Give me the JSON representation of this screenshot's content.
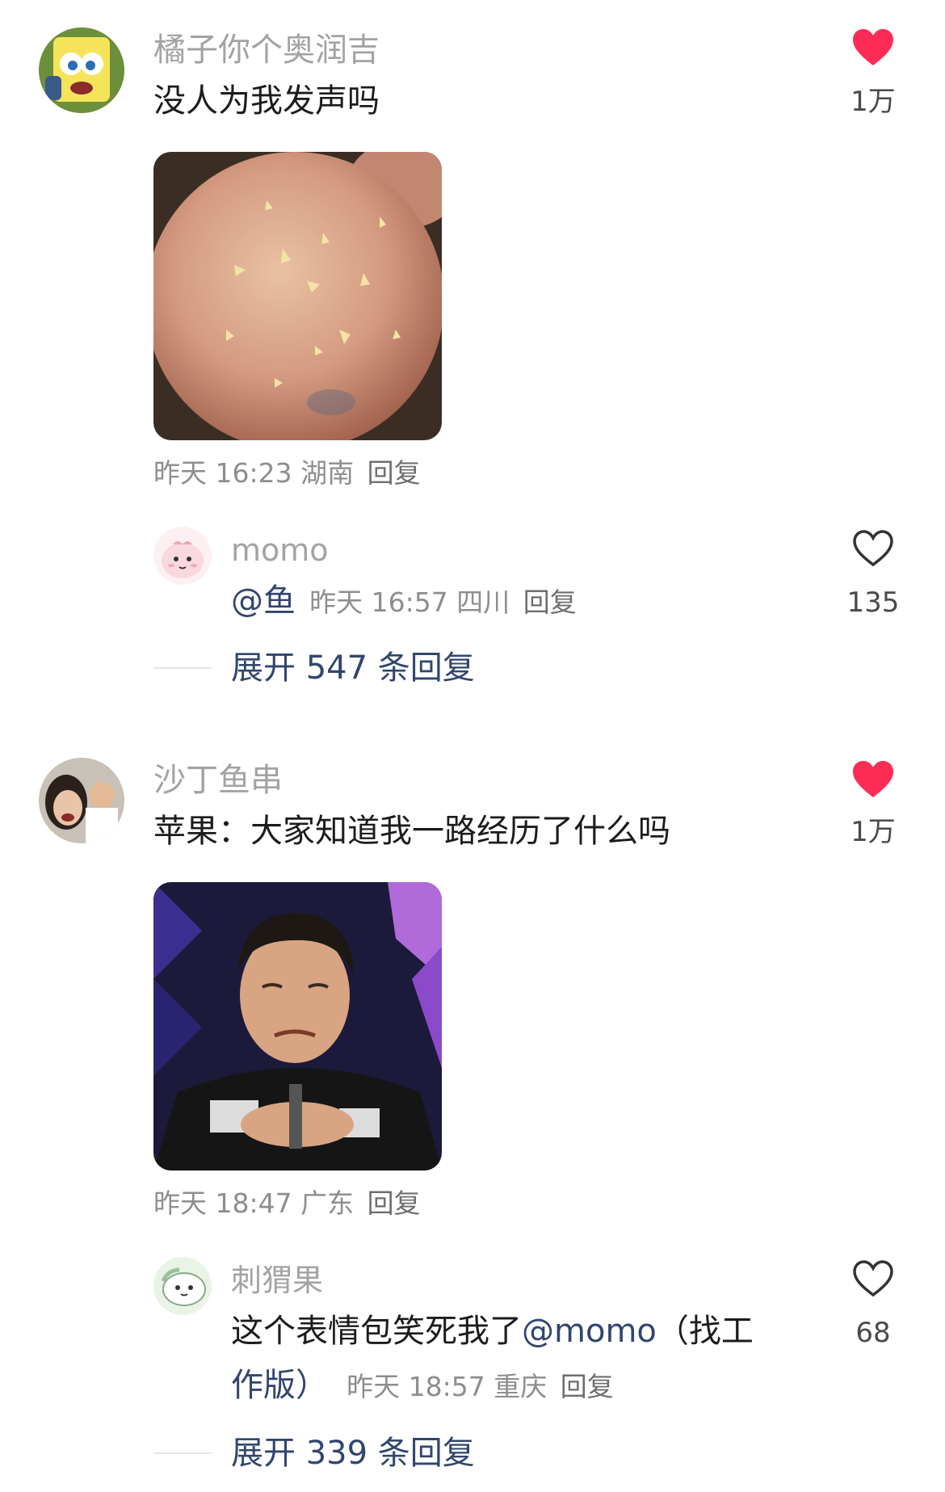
{
  "comments": [
    {
      "author": "橘子你个奥润吉",
      "text": "没人为我发声吗",
      "likes": "1万",
      "liked": true,
      "image": "apple-with-stems-photo",
      "meta": {
        "time": "昨天 16:23",
        "location": "湖南",
        "reply": "回复"
      },
      "reply": {
        "author": "momo",
        "mention": "@鱼",
        "meta": {
          "time": "昨天 16:57",
          "location": "四川",
          "reply": "回复"
        },
        "likes": "135",
        "liked": false
      },
      "expand": "展开 547 条回复"
    },
    {
      "author": "沙丁鱼串",
      "text": "苹果：大家知道我一路经历了什么吗",
      "likes": "1万",
      "liked": true,
      "image": "crying-man-meme-photo",
      "meta": {
        "time": "昨天 18:47",
        "location": "广东",
        "reply": "回复"
      },
      "reply": {
        "author": "刺猬果",
        "text_line1_a": "这个表情包笑死我了",
        "text_line1_mention": "@momo",
        "text_line1_b": "（找工",
        "text_line2": "作版）",
        "meta": {
          "time": "昨天 18:57",
          "location": "重庆",
          "reply": "回复"
        },
        "likes": "68",
        "liked": false
      },
      "expand": "展开 339 条回复"
    }
  ],
  "colors": {
    "like_red": "#fe2c55",
    "link_blue": "#31466e"
  },
  "icons": [
    "heart-filled-icon",
    "heart-outline-icon"
  ]
}
